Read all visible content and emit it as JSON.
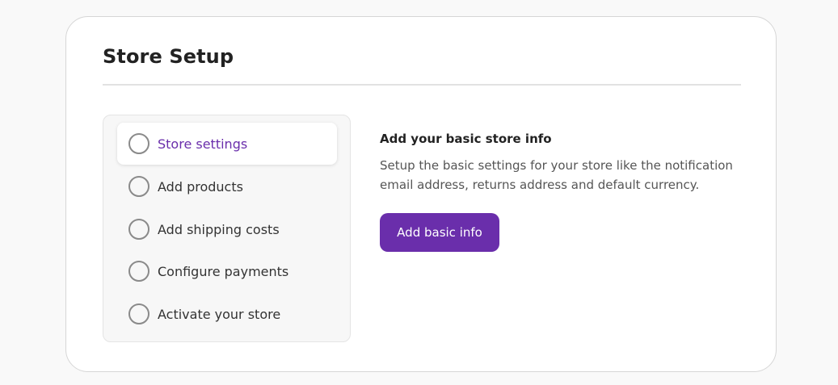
{
  "header": {
    "title": "Store Setup"
  },
  "steps": [
    {
      "label": "Store settings",
      "active": true
    },
    {
      "label": "Add products",
      "active": false
    },
    {
      "label": "Add shipping costs",
      "active": false
    },
    {
      "label": "Configure payments",
      "active": false
    },
    {
      "label": "Activate your store",
      "active": false
    }
  ],
  "detail": {
    "title": "Add your basic store info",
    "description": "Setup the basic settings for your store like the notification email address, returns address and default currency.",
    "button_label": "Add basic info"
  },
  "colors": {
    "accent": "#6a2eab",
    "page_background": "#f9f9f9",
    "card_background": "#ffffff"
  }
}
